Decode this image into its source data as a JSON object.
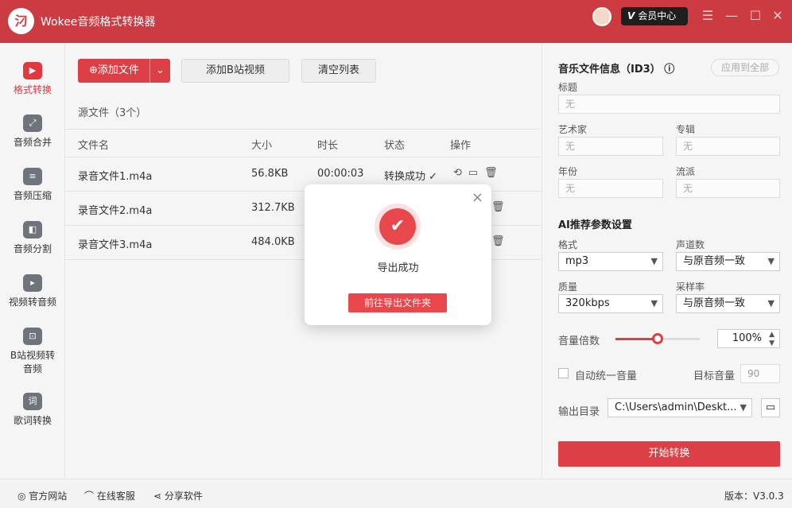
{
  "app": {
    "logo": "汈",
    "title": "Wokee音频格式转换器",
    "vip_label": "会员中心",
    "vip_icon": "V"
  },
  "window_controls": {
    "menu": "☰",
    "minimize": "—",
    "maximize": "☐",
    "close": "✕"
  },
  "sidebar": {
    "items": [
      {
        "label": "格式转换",
        "icon": "▶",
        "active": true
      },
      {
        "label": "音频合并",
        "icon": "⤢"
      },
      {
        "label": "音频压缩",
        "icon": "≡"
      },
      {
        "label": "音频分割",
        "icon": "◧"
      },
      {
        "label": "视频转音频",
        "icon": "▸"
      },
      {
        "label": "B站视频转音频",
        "icon": "⊡"
      },
      {
        "label": "歌词转换",
        "icon": "词"
      }
    ]
  },
  "toolbar": {
    "add_file": "⊕添加文件",
    "add_file_arrow": "⌄",
    "add_bilibili": "添加B站视频",
    "clear_list": "清空列表"
  },
  "source": {
    "count_label": "源文件（3个）"
  },
  "table": {
    "headers": [
      "文件名",
      "大小",
      "时长",
      "状态",
      "操作"
    ],
    "rows": [
      {
        "name": "录音文件1.m4a",
        "size": "56.8KB",
        "duration": "00:00:03",
        "status": "转换成功 ✓",
        "ops": "⟲▭🗑"
      },
      {
        "name": "录音文件2.m4a",
        "size": "312.7KB",
        "duration": "",
        "status": "",
        "ops": "🗑"
      },
      {
        "name": "录音文件3.m4a",
        "size": "484.0KB",
        "duration": "",
        "status": "",
        "ops": "🗑"
      }
    ]
  },
  "id3": {
    "title": "音乐文件信息（ID3）",
    "info_icon": "ⓘ",
    "apply_all": "应用到全部",
    "fields": {
      "title_label": "标题",
      "artist_label": "艺术家",
      "album_label": "专辑",
      "year_label": "年份",
      "genre_label": "流派",
      "placeholder": "无"
    }
  },
  "ai": {
    "title": "AI推荐参数设置",
    "format_label": "格式",
    "format_value": "mp3",
    "channels_label": "声道数",
    "channels_value": "与原音频一致",
    "quality_label": "质量",
    "quality_value": "320kbps",
    "samplerate_label": "采样率",
    "samplerate_value": "与原音频一致",
    "volume_label": "音量倍数",
    "volume_value": "100%",
    "volume_level": 0.5,
    "auto_volume_label": "自动统一音量",
    "target_volume_label": "目标音量",
    "target_volume_value": "90",
    "output_label": "输出目录",
    "output_value": "C:\\Users\\admin\\Deskt...",
    "start_label": "开始转换"
  },
  "footer": {
    "site": "◎ 官方网站",
    "service": "⌒ 在线客服",
    "share": "⋖ 分享软件",
    "version": "版本：V3.0.3"
  },
  "modal": {
    "close": "×",
    "check": "✔",
    "message": "导出成功",
    "button": "前往导出文件夹"
  }
}
